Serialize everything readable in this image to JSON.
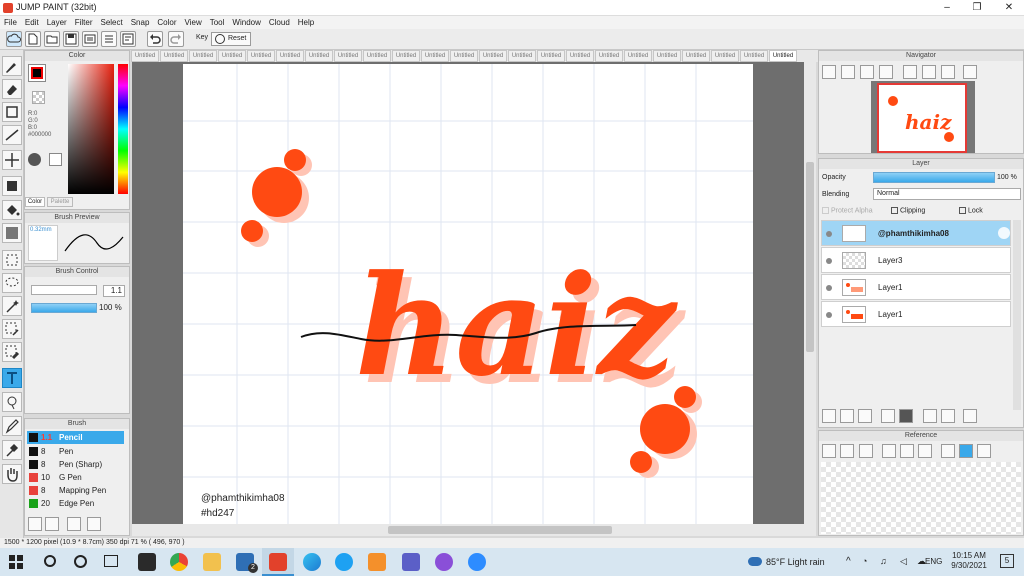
{
  "window": {
    "title": "JUMP PAINT (32bit)"
  },
  "menu": [
    "File",
    "Edit",
    "Layer",
    "Filter",
    "Select",
    "Snap",
    "Color",
    "View",
    "Tool",
    "Window",
    "Cloud",
    "Help"
  ],
  "toolbar": {
    "key_label": "Key",
    "reset_label": "Reset"
  },
  "tabs": {
    "label": "Untitled",
    "count": 23
  },
  "color_panel": {
    "title": "Color",
    "r": "R:0",
    "g": "G:0",
    "b": "B:0",
    "hex": "#000000",
    "tab_color": "Color",
    "tab_palette": "Palette",
    "fg": "#000000"
  },
  "brush_preview": {
    "title": "Brush Preview",
    "size": "0.32mm"
  },
  "brush_control": {
    "title": "Brush Control",
    "size_value": "1.1",
    "opacity_value": "100 %"
  },
  "brush_panel": {
    "title": "Brush",
    "items": [
      {
        "size": "1.1",
        "name": "Pencil",
        "color": "#111111"
      },
      {
        "size": "8",
        "name": "Pen",
        "color": "#111111"
      },
      {
        "size": "8",
        "name": "Pen (Sharp)",
        "color": "#111111"
      },
      {
        "size": "10",
        "name": "G Pen",
        "color": "#e8423b"
      },
      {
        "size": "8",
        "name": "Mapping Pen",
        "color": "#e8423b"
      },
      {
        "size": "20",
        "name": "Edge Pen",
        "color": "#1aa31a"
      }
    ]
  },
  "artwork": {
    "word": "haiz",
    "credit": "@phamthikimha08",
    "tag": "#hd247",
    "main_color": "#ff4a12",
    "shadow_color": "#ffc4b4"
  },
  "navigator": {
    "title": "Navigator"
  },
  "layer_panel": {
    "title": "Layer",
    "opacity_label": "Opacity",
    "opacity_value": "100 %",
    "opacity_fraction": 1.0,
    "blending_label": "Blending",
    "blending_value": "Normal",
    "protect_alpha": "Protect Alpha",
    "clipping": "Clipping",
    "lock": "Lock",
    "layers": [
      "@phamthikimha08",
      "Layer3",
      "Layer1",
      "Layer1"
    ]
  },
  "reference": {
    "title": "Reference"
  },
  "status": {
    "text": "1500 * 1200 pixel   (10.9 * 8.7cm)  350 dpi  71 %  ( 496, 970 )"
  },
  "taskbar": {
    "weather": "85°F  Light rain",
    "lang": "ENG",
    "time": "10:15 AM",
    "date": "9/30/2021",
    "notif": "5",
    "mail_badge": "2"
  }
}
